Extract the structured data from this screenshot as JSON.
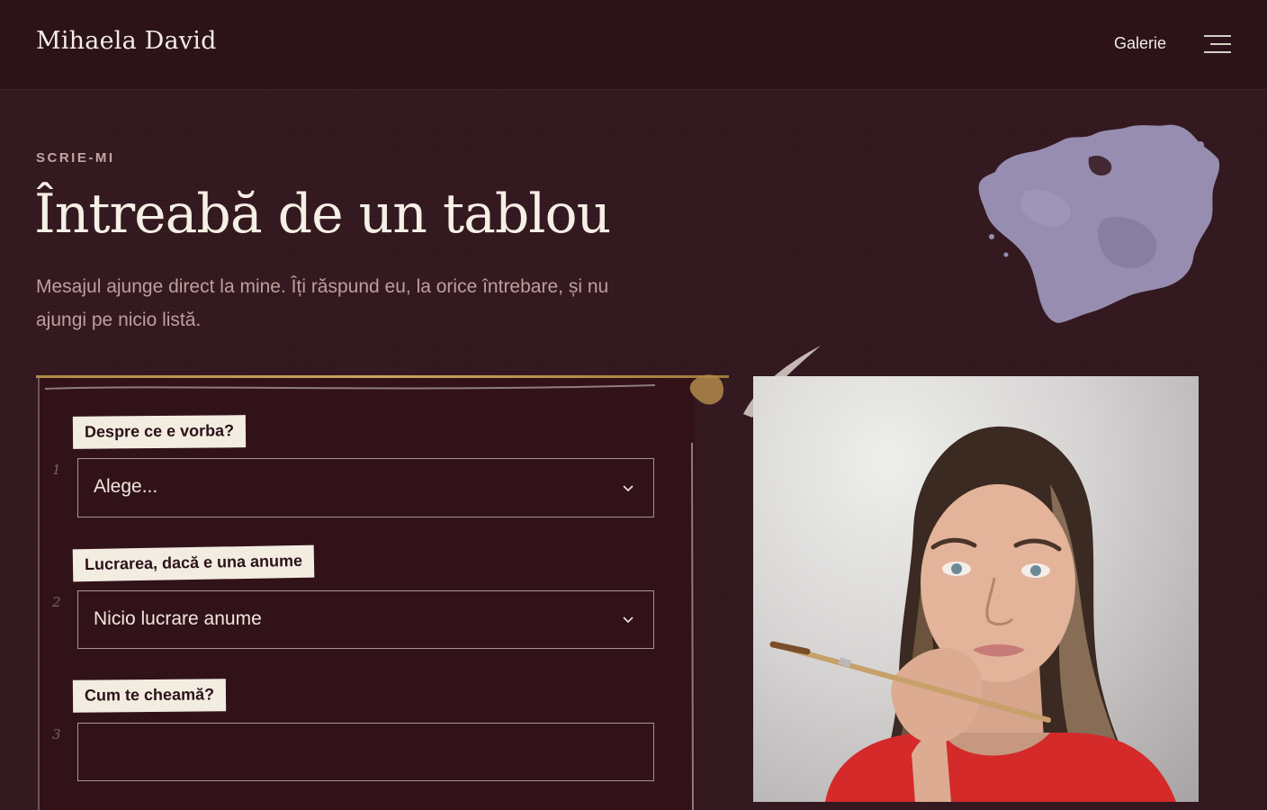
{
  "header": {
    "brand": "Mihaela David",
    "nav_link": "Galerie",
    "menu_icon": "hamburger-menu-icon"
  },
  "hero": {
    "eyebrow": "SCRIE-MI",
    "title": "Întreabă de un tablou",
    "lead": "Mesajul ajunge direct la mine. Îți răspund eu, la orice întrebare, și nu ajungi pe nicio listă."
  },
  "form": {
    "fields": [
      {
        "number": "1",
        "label": "Despre ce e vorba?",
        "value": "Alege...",
        "type": "select"
      },
      {
        "number": "2",
        "label": "Lucrarea, dacă e una anume",
        "value": "Nicio lucrare anume",
        "type": "select"
      },
      {
        "number": "3",
        "label": "Cum te cheamă?",
        "value": "",
        "type": "text"
      }
    ]
  },
  "colors": {
    "background": "#33191f",
    "header": "#2b1319",
    "card": "#321219",
    "label_paper": "#f3ece1",
    "gold_accent": "#c9a560",
    "paint_splash": "#9b90b4",
    "shirt_red": "#d42a2a"
  },
  "icons": {
    "chevron": "chevron-down-icon",
    "decor": "paint-splash-icon"
  }
}
